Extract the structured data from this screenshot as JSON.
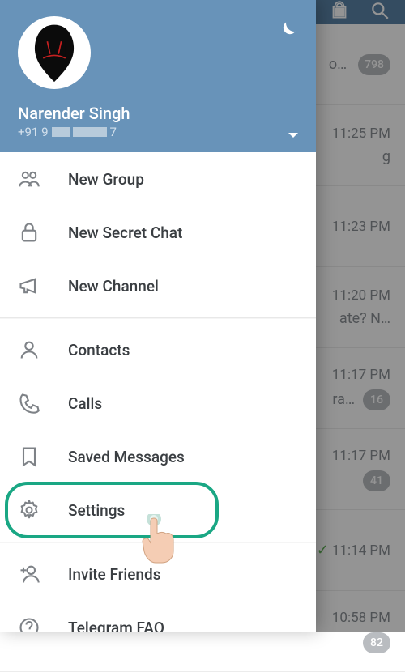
{
  "header": {
    "name": "Narender Singh",
    "phone_prefix": "+91 9",
    "phone_suffix": "7"
  },
  "menu": {
    "new_group": "New Group",
    "new_secret_chat": "New Secret Chat",
    "new_channel": "New Channel",
    "contacts": "Contacts",
    "calls": "Calls",
    "saved_messages": "Saved Messages",
    "settings": "Settings",
    "invite_friends": "Invite Friends",
    "telegram_faq": "Telegram FAQ"
  },
  "bg_chats": [
    {
      "preview": "o…",
      "time": "",
      "badge": "798"
    },
    {
      "preview": "g",
      "time": "11:25 PM",
      "badge": ""
    },
    {
      "preview": "",
      "time": "11:23 PM",
      "badge": ""
    },
    {
      "preview": "ate? N…",
      "time": "11:20 PM",
      "badge": ""
    },
    {
      "preview": "ra…",
      "time": "11:17 PM",
      "badge": "16"
    },
    {
      "preview": "",
      "time": "11:17 PM",
      "badge": "41"
    },
    {
      "preview": "",
      "time": "11:14 PM",
      "badge": "",
      "checked": true
    },
    {
      "preview": "",
      "time": "10:58 PM",
      "badge": "82"
    }
  ]
}
